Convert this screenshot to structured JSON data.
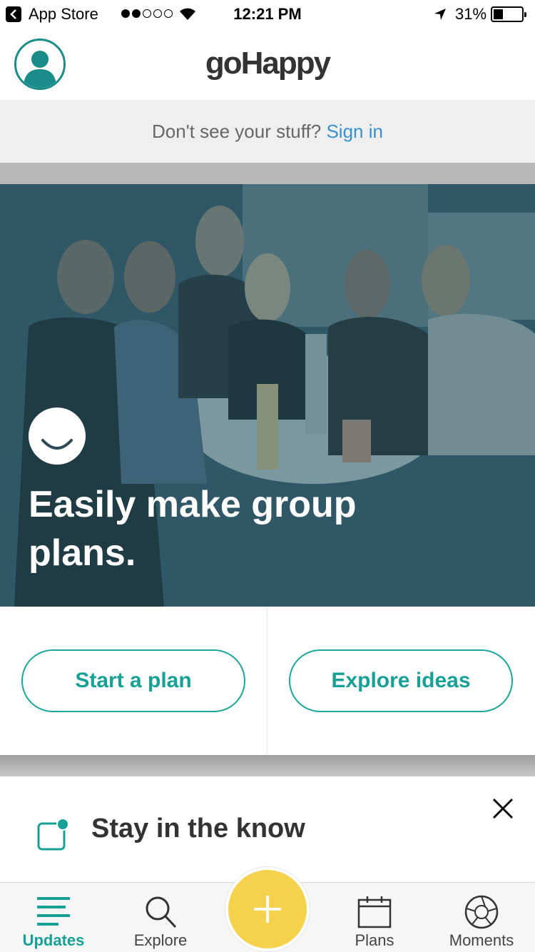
{
  "status_bar": {
    "back_app": "App Store",
    "time": "12:21 PM",
    "battery_pct": "31%"
  },
  "header": {
    "logo": "goHappy"
  },
  "signin_bar": {
    "prompt": "Don't see your stuff?",
    "link": "Sign in"
  },
  "hero": {
    "headline": "Easily make group plans."
  },
  "actions": {
    "start_plan": "Start a plan",
    "explore_ideas": "Explore ideas"
  },
  "card": {
    "title": "Stay in the know"
  },
  "tab_bar": {
    "tabs": [
      {
        "label": "Updates",
        "icon": "updates-icon",
        "active": true
      },
      {
        "label": "Explore",
        "icon": "search-icon",
        "active": false
      },
      {
        "label": "",
        "icon": "plus-icon",
        "active": false
      },
      {
        "label": "Plans",
        "icon": "calendar-icon",
        "active": false
      },
      {
        "label": "Moments",
        "icon": "aperture-icon",
        "active": false
      }
    ]
  },
  "colors": {
    "accent": "#17a095",
    "link": "#3a8fd1",
    "add_button": "#f6d14c"
  }
}
